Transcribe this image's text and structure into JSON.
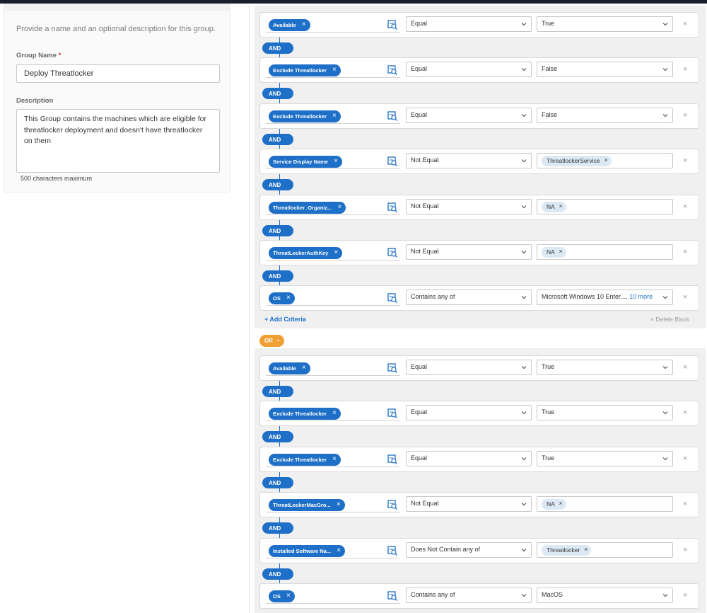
{
  "form": {
    "intro": "Provide a name and an optional description for this group.",
    "group_name_label": "Group Name",
    "required_marker": "*",
    "group_name_value": "Deploy Threatlocker",
    "description_label": "Description",
    "description_value": "This Group contains the machines which are eligible for threatlocker deployment and doesn't have threatlocker on them",
    "description_hint": "500 characters maximum"
  },
  "colors": {
    "accent": "#1e6fc7",
    "or_badge": "#f0a032",
    "block_bg": "#f0f0f0"
  },
  "labels": {
    "and": "AND",
    "or": "OR",
    "add_criteria": "+ Add Criteria",
    "delete_block": "× Delete Block",
    "remove": "×",
    "chip_remove": "×",
    "field_picker_icon": "field-picker-icon"
  },
  "blocks": [
    {
      "criteria": [
        {
          "field": "Available",
          "operator": "Equal",
          "value": "True"
        },
        {
          "field": "Exclude Threatlocker",
          "operator": "Equal",
          "value": "False"
        },
        {
          "field": "Exclude Threatlocker",
          "operator": "Equal",
          "value": "False"
        },
        {
          "field": "Service Display Name",
          "operator": "Not Equal",
          "value_tag": "ThreatlockerService"
        },
        {
          "field": "Threatlocker_Organiz...",
          "operator": "Not Equal",
          "value_tag": "NA"
        },
        {
          "field": "ThreatLockerAuthKey",
          "operator": "Not Equal",
          "value_tag": "NA"
        },
        {
          "field": "OS",
          "operator": "Contains any of",
          "value": "Microsoft Windows 10 Enter...,",
          "value_more": "10 more"
        }
      ]
    },
    {
      "criteria": [
        {
          "field": "Available",
          "operator": "Equal",
          "value": "True"
        },
        {
          "field": "Exclude Threatlocker",
          "operator": "Equal",
          "value": "True"
        },
        {
          "field": "Exclude Threatlocker",
          "operator": "Equal",
          "value": "True"
        },
        {
          "field": "ThreatLockerMacGro...",
          "operator": "Not Equal",
          "value_tag": "NA"
        },
        {
          "field": "Installed Software Na...",
          "operator": "Does Not Contain any of",
          "value_tag": "Threatlocker"
        },
        {
          "field": "OS",
          "operator": "Contains any of",
          "value": "MacOS"
        }
      ]
    }
  ]
}
